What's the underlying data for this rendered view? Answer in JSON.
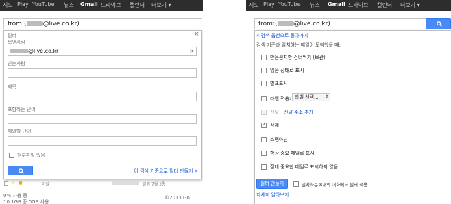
{
  "gbar": {
    "left": {
      "items": [
        "지도",
        "Play",
        "YouTube",
        "뉴스",
        "Gmail",
        "드라이브",
        "캘린더",
        "더보기 ▾"
      ]
    },
    "right": {
      "items": [
        "지도",
        "Play",
        "YouTube",
        "뉴스",
        "Gmail",
        "드라이브",
        "캘린더",
        "더보기 ▾"
      ]
    },
    "active": "Gmail",
    "bg_color": "#2d2d2d"
  },
  "left": {
    "search_prefix": "from:(",
    "search_suffix": "@live.co.kr)",
    "filter_title": "필터",
    "from_label": "보낸사람",
    "from_value": "@live.co.kr",
    "to_label": "받는사람",
    "subject_label": "제목",
    "has_words_label": "포함하는 단어",
    "no_words_label": "제외할 단어",
    "attachment_label": "첨부파일 있음",
    "create_link": "이 검색 기준으로 필터 만들기 »",
    "bg_row_text": "아날",
    "bg_row_text2": "알림 7월 2통",
    "footer_usage": "0% 사용 중",
    "footer_quota": "10.1GB 중 0GB 사용",
    "footer_copy": "©2013 Go"
  },
  "right": {
    "search_prefix": "from:(",
    "search_suffix": "@live.co.kr)",
    "back_link": "« 검색 옵션으로 돌아가기",
    "instruction": "검색 기준과 일치하는 메일이 도착했을 때:",
    "options": [
      {
        "label": "받은편지함 건너뛰기 (보관)",
        "checked": false
      },
      {
        "label": "읽은 상태로 표시",
        "checked": false
      },
      {
        "label": "별표표시",
        "checked": false
      },
      {
        "label": "라벨 적용:",
        "checked": false
      },
      {
        "label": "전달",
        "checked": false,
        "disabled": true
      },
      {
        "label": "삭제",
        "checked": true
      },
      {
        "label": "스팸아님",
        "checked": false
      },
      {
        "label": "항상 중요 메일로 표시",
        "checked": false
      },
      {
        "label": "절대 중요한 메일로 표시하지 않음",
        "checked": false
      }
    ],
    "label_select": "라벨 선택...",
    "forward_link": "전달 주소 추가",
    "create_button": "필터 만들기",
    "also_apply": "일치하는 8개의 대화에도 필터 적용",
    "learn_more": "자세히 알아보기"
  },
  "colors": {
    "accent": "#4a8af4",
    "link": "#1155cc"
  }
}
